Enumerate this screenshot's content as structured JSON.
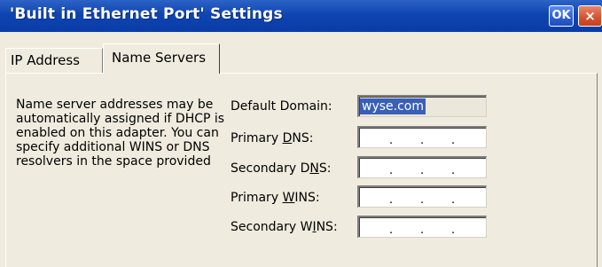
{
  "window": {
    "title": "'Built in Ethernet Port' Settings",
    "ok_label": "OK",
    "close_label": "×"
  },
  "tabs": [
    {
      "label": "IP Address",
      "selected": false
    },
    {
      "label": "Name Servers",
      "selected": true
    }
  ],
  "description": "Name server addresses may be automatically assigned if DHCP is enabled on this adapter.  You can specify additional WINS or DNS resolvers in the space provided",
  "fields": {
    "default_domain": {
      "label": "Default Domain:",
      "value": "wyse.com"
    },
    "primary_dns": {
      "label_pre": "Primary ",
      "label_key": "D",
      "label_post": "NS:",
      "value": ""
    },
    "secondary_dns": {
      "label_pre": "Secondary D",
      "label_key": "N",
      "label_post": "S:",
      "value": ""
    },
    "primary_wins": {
      "label_pre": "Primary ",
      "label_key": "W",
      "label_post": "INS:",
      "value": ""
    },
    "secondary_wins": {
      "label_pre": "Secondary W",
      "label_key": "I",
      "label_post": "NS:",
      "value": ""
    }
  },
  "ip_separator": "."
}
